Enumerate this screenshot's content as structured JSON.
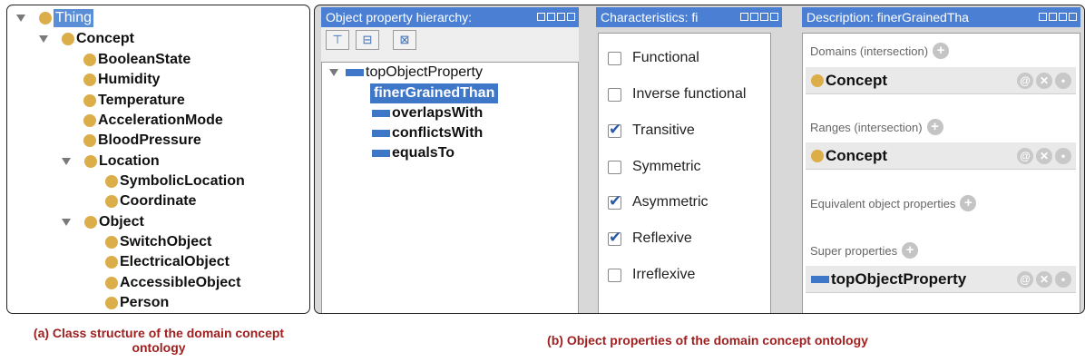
{
  "class_tree": {
    "root": "Thing",
    "concept": "Concept",
    "concept_children": [
      "BooleanState",
      "Humidity",
      "Temperature",
      "AccelerationMode",
      "BloodPressure"
    ],
    "location": "Location",
    "location_children": [
      "SymbolicLocation",
      "Coordinate"
    ],
    "object": "Object",
    "object_children": [
      "SwitchObject",
      "ElectricalObject",
      "AccessibleObject",
      "Person"
    ]
  },
  "hierarchy": {
    "title": "Object property hierarchy:",
    "root": "topObjectProperty",
    "children": [
      "finerGrainedThan",
      "overlapsWith",
      "conflictsWith",
      "equalsTo"
    ],
    "selected": "finerGrainedThan"
  },
  "characteristics": {
    "title": "Characteristics: fi",
    "items": [
      {
        "label": "Functional",
        "checked": false
      },
      {
        "label": "Inverse functional",
        "checked": false
      },
      {
        "label": "Transitive",
        "checked": true
      },
      {
        "label": "Symmetric",
        "checked": false
      },
      {
        "label": "Asymmetric",
        "checked": true
      },
      {
        "label": "Reflexive",
        "checked": true
      },
      {
        "label": "Irreflexive",
        "checked": false
      }
    ]
  },
  "description": {
    "title": "Description: finerGrainedTha",
    "domains_label": "Domains (intersection)",
    "domain_value": "Concept",
    "ranges_label": "Ranges (intersection)",
    "range_value": "Concept",
    "equivalent_label": "Equivalent object properties",
    "super_label": "Super properties",
    "super_value": "topObjectProperty"
  },
  "captions": {
    "a": "(a) Class structure of the domain concept ontology",
    "b": "(b) Object properties of the domain concept ontology"
  },
  "colors": {
    "class_dot": "#dcae4a",
    "property_bar": "#3f77c8",
    "header": "#4a7fd3",
    "caption": "#a01f1f"
  }
}
